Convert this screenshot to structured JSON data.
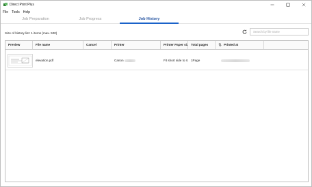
{
  "window": {
    "title": "Direct Print Plus",
    "controls": [
      "minimize-icon",
      "maximize-icon",
      "close-icon"
    ]
  },
  "menu": [
    "File",
    "Tools",
    "Help"
  ],
  "tabs": [
    {
      "label": "Job Preparation",
      "active": false
    },
    {
      "label": "Job Progress",
      "active": false
    },
    {
      "label": "Job History",
      "active": true
    }
  ],
  "history": {
    "size_text": "Size of history list: 1 items (max. 500)",
    "search_placeholder": "Search by file name",
    "refresh_icon": "refresh-icon"
  },
  "table": {
    "columns": [
      "Preview",
      "File name",
      "Cancel",
      "Printer",
      "Printer Paper siz",
      "Total pages",
      "Printed at"
    ],
    "sorted_column_icon": "sort-updown-icon",
    "rows": [
      {
        "preview": "document-thumbnail",
        "file_name": "elevation.pdf",
        "cancel": "",
        "printer": "Canon",
        "paper_size": "Fit short side to roll",
        "total_pages": "1Page",
        "printed_at": ""
      }
    ]
  },
  "colors": {
    "accent": "#1a62c9",
    "active_tab_text": "#1f4f9e",
    "inactive_tab_text": "#9a9a9a"
  }
}
